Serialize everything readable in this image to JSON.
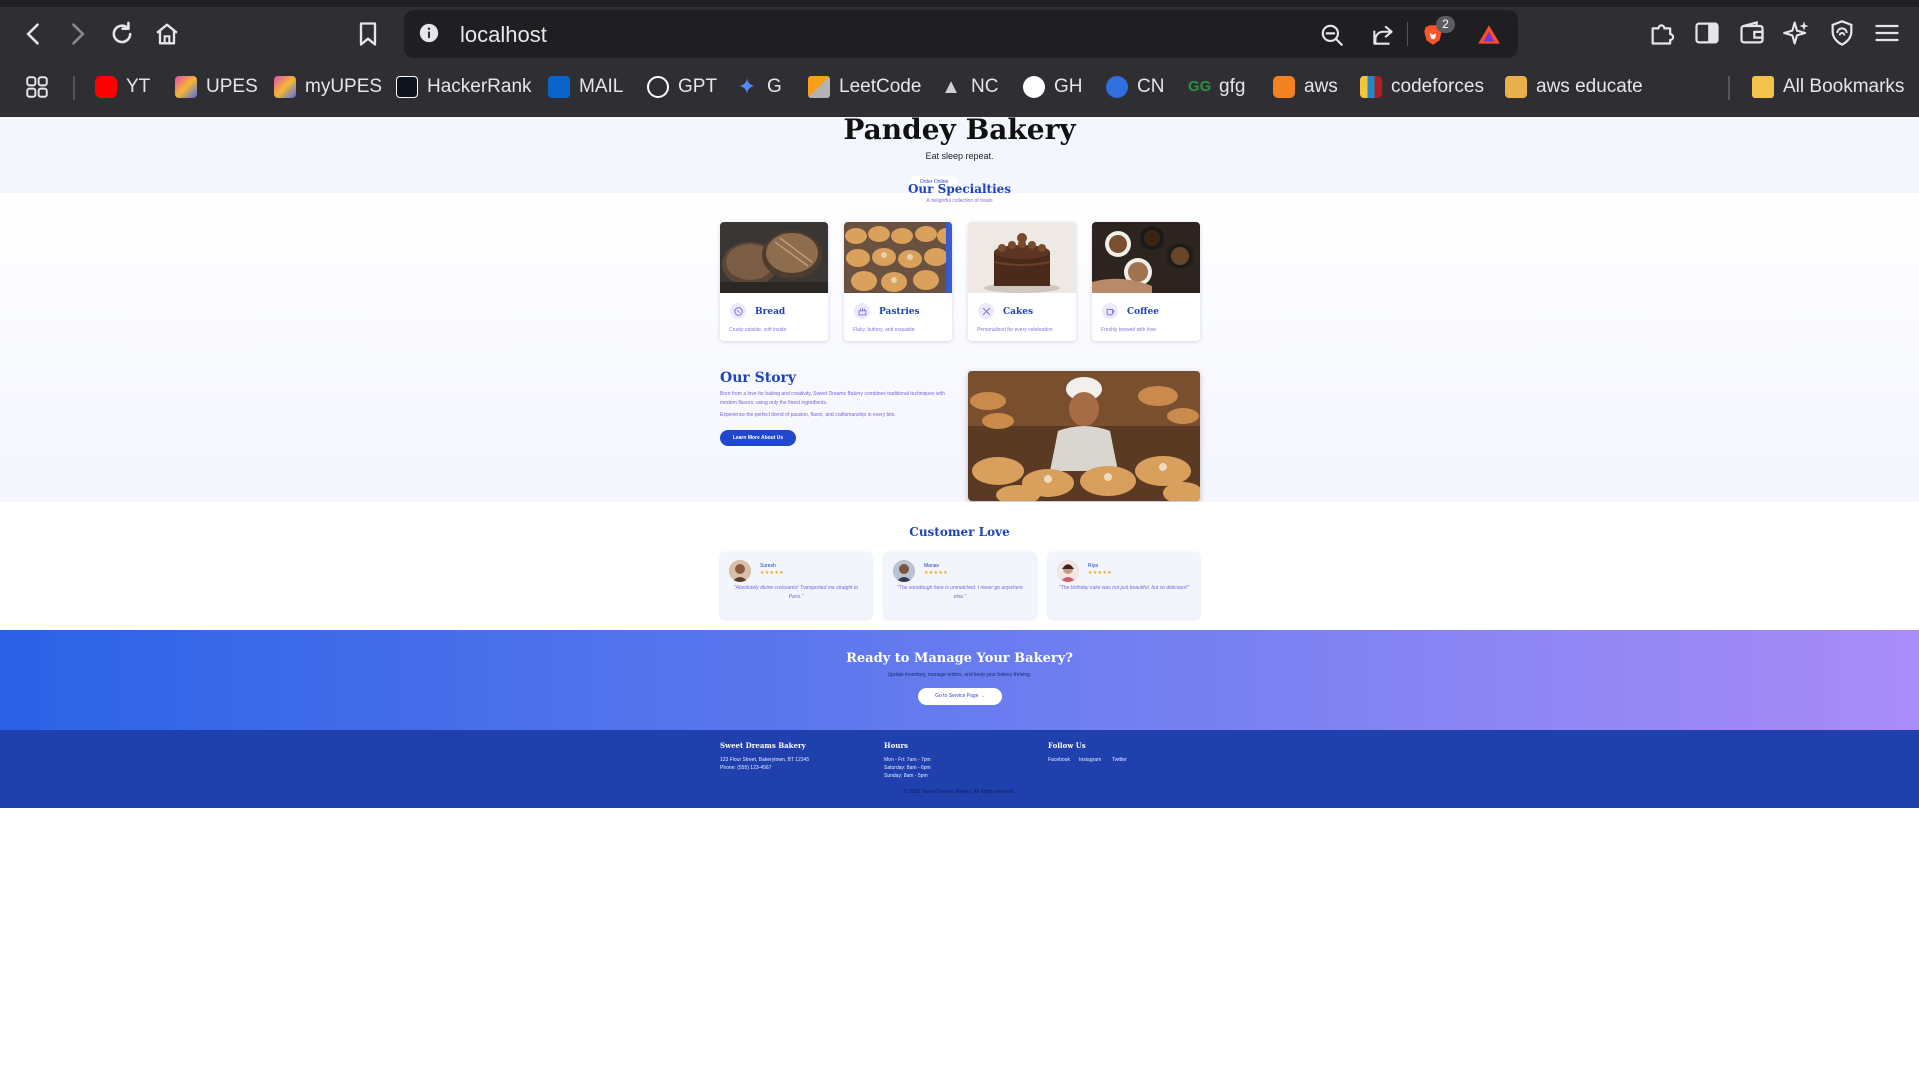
{
  "browser": {
    "url": "localhost",
    "tab_badge": "2",
    "bookmarks": [
      {
        "label": "YT",
        "icon": "youtube-icon",
        "color": "#ff0000"
      },
      {
        "label": "UPES",
        "icon": "upes-icon",
        "color": "#e14bb5"
      },
      {
        "label": "myUPES",
        "icon": "upes-icon",
        "color": "#e14bb5"
      },
      {
        "label": "HackerRank",
        "icon": "hackerrank-icon",
        "color": "#1ba94c"
      },
      {
        "label": "MAIL",
        "icon": "outlook-icon",
        "color": "#0a64c9"
      },
      {
        "label": "GPT",
        "icon": "openai-icon",
        "color": "#ffffff"
      },
      {
        "label": "G",
        "icon": "gemini-icon",
        "color": "#4e8cf7"
      },
      {
        "label": "LeetCode",
        "icon": "leetcode-icon",
        "color": "#f89f1b"
      },
      {
        "label": "NC",
        "icon": "rocket-icon",
        "color": "#d0d0d0"
      },
      {
        "label": "GH",
        "icon": "github-icon",
        "color": "#ffffff"
      },
      {
        "label": "CN",
        "icon": "codingninjas-icon",
        "color": "#2f6fe0"
      },
      {
        "label": "gfg",
        "icon": "gfg-icon",
        "color": "#2f8d46"
      },
      {
        "label": "aws",
        "icon": "aws-icon",
        "color": "#f58220"
      },
      {
        "label": "codeforces",
        "icon": "codeforces-icon",
        "color": "#f6c43d"
      },
      {
        "label": "aws educate",
        "icon": "box-icon",
        "color": "#e8b04a"
      }
    ],
    "all_bookmarks": "All Bookmarks"
  },
  "hero": {
    "title": "Pandey Bakery",
    "tagline": "Eat sleep repeat.",
    "order_button": "Order Online"
  },
  "specialties": {
    "title": "Our Specialties",
    "subtitle": "A delightful collection of treats",
    "items": [
      {
        "name": "Bread",
        "desc": "Crusty outside, soft inside",
        "icon": "bread-icon"
      },
      {
        "name": "Pastries",
        "desc": "Flaky, buttery, and exquisite",
        "icon": "pastry-icon"
      },
      {
        "name": "Cakes",
        "desc": "Personalized for every celebration",
        "icon": "cake-icon"
      },
      {
        "name": "Coffee",
        "desc": "Freshly brewed with love",
        "icon": "coffee-icon"
      }
    ]
  },
  "story": {
    "title": "Our Story",
    "p1": "Born from a love for baking and creativity, Sweet Dreams Bakery combines traditional techniques with modern flavors, using only the finest ingredients.",
    "p2": "Experience the perfect blend of passion, flavor, and craftsmanship in every bite.",
    "button": "Learn More About Us"
  },
  "testimonials": {
    "title": "Customer Love",
    "stars": "★★★★★",
    "items": [
      {
        "name": "Suresh",
        "quote": "\"Absolutely divine croissants! Transported me straight to Paris.\""
      },
      {
        "name": "Manav",
        "quote": "\"The sourdough here is unmatched. I never go anywhere else.\""
      },
      {
        "name": "Riya",
        "quote": "\"The birthday cake was not just beautiful, but so delicious!\""
      }
    ]
  },
  "cta": {
    "title": "Ready to Manage Your Bakery?",
    "subtitle": "Update inventory, manage orders, and keep your bakery thriving.",
    "button": "Go to Service Page →"
  },
  "footer": {
    "brand": "Sweet Dreams Bakery",
    "address": "123 Flour Street, Bakerytown, BT 12345",
    "phone": "Phone: (555) 123-4567",
    "hours_title": "Hours",
    "hours": [
      "Mon - Fri: 7am - 7pm",
      "Saturday: 8am - 6pm",
      "Sunday: 8am - 5pm"
    ],
    "follow_title": "Follow Us",
    "social": [
      "Facebook",
      "Instagram",
      "Twitter"
    ],
    "copyright": "© 2025 Sweet Dreams Bakery. All rights reserved."
  }
}
